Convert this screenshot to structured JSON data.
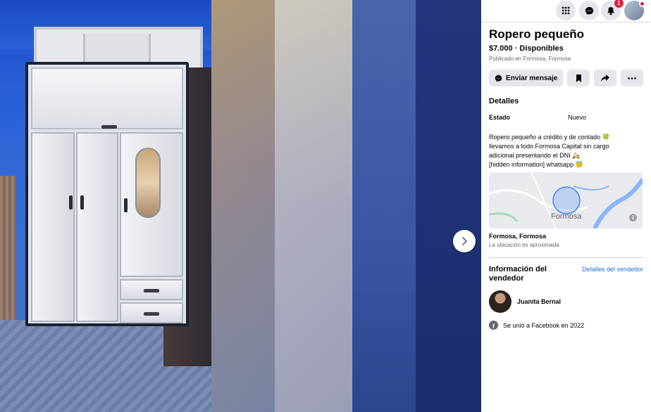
{
  "topbar": {
    "notification_count": "1"
  },
  "listing": {
    "title": "Ropero pequeño",
    "price_status": "$7.000 · Disponibles",
    "published": "Publicado en Formosa, Formosa",
    "message_button": "Enviar mensaje"
  },
  "details": {
    "heading": "Detalles",
    "condition_label": "Estado",
    "condition_value": "Nuevo",
    "description": "Ropero pequeño a crédito y de contado 🍀\nllevamos a todo Formosa Capital sin cargo\nadicional presentando el DNI 🛵\n[hidden information] whatsapp 😇"
  },
  "location": {
    "map_label": "Formosa",
    "name": "Formosa, Formosa",
    "note": "La ubicación es aproximada"
  },
  "seller": {
    "heading": "Información del vendedor",
    "details_link": "Detalles del vendedor",
    "name": "Juanita Bernal",
    "joined": "Se unió a Facebook en 2022"
  },
  "colors": {
    "link": "#216fdb",
    "badge": "#e41e3f",
    "button_bg": "#e4e6eb"
  }
}
